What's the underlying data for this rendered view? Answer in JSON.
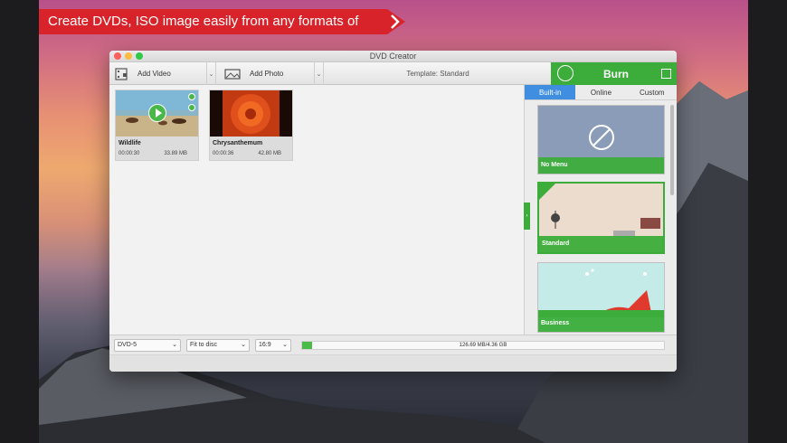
{
  "promo": {
    "text": "Create DVDs, ISO image easily from any formats of videos."
  },
  "window": {
    "title": "DVD Creator"
  },
  "toolbar": {
    "add_video": "Add Video",
    "add_photo": "Add Photo",
    "template": "Template: Standard",
    "burn": "Burn"
  },
  "clips": [
    {
      "name": "Wildlife",
      "duration": "00:00:30",
      "size": "33.89 MB"
    },
    {
      "name": "Chrysanthemum",
      "duration": "00:00:36",
      "size": "42.80 MB"
    }
  ],
  "panel": {
    "tabs": [
      "Built-in",
      "Online",
      "Custom"
    ],
    "active_tab": "Built-in",
    "templates": [
      "No Menu",
      "Standard",
      "Business"
    ],
    "selected_template": "Standard"
  },
  "status": {
    "disc_type": "DVD-5",
    "fit": "Fit to disc",
    "aspect": "16:9",
    "capacity": "126.69 MB/4.36 GB",
    "capacity_fraction": 0.028
  },
  "colors": {
    "accent_green": "#3cad3a",
    "tab_blue": "#3f8ee0",
    "promo_red": "#d8232a"
  }
}
